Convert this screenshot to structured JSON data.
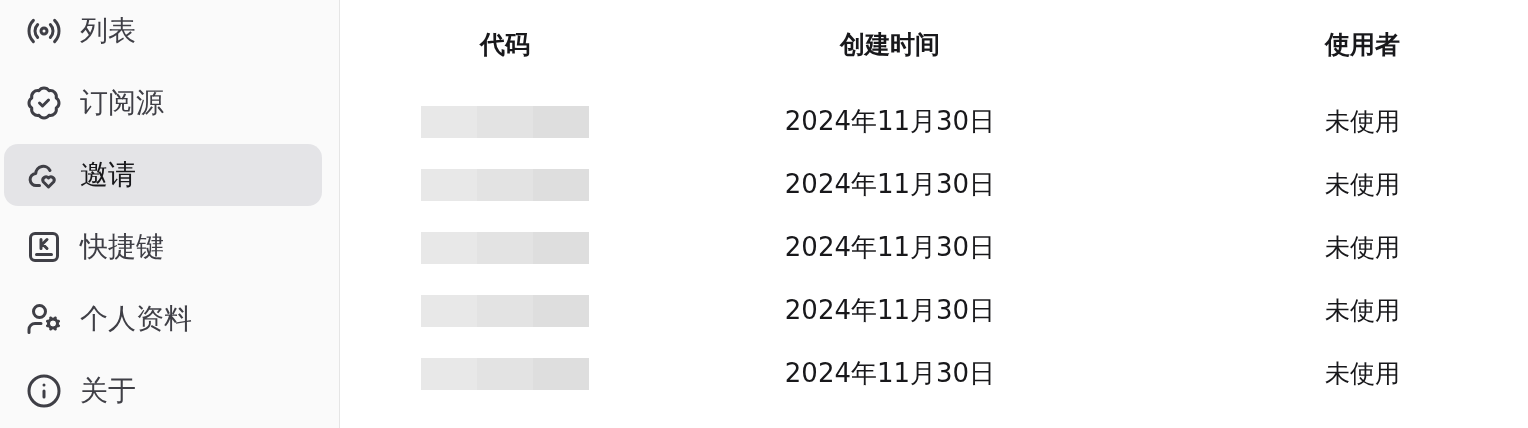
{
  "sidebar": {
    "items": [
      {
        "label": "列表",
        "selected": false
      },
      {
        "label": "订阅源",
        "selected": false
      },
      {
        "label": "邀请",
        "selected": true
      },
      {
        "label": "快捷键",
        "selected": false
      },
      {
        "label": "个人资料",
        "selected": false
      },
      {
        "label": "关于",
        "selected": false
      }
    ]
  },
  "table": {
    "columns": [
      "代码",
      "创建时间",
      "使用者"
    ],
    "rows": [
      {
        "code": {
          "kind": "redacted"
        },
        "created": "2024年11月30日",
        "user": "未使用"
      },
      {
        "code": {
          "kind": "redacted"
        },
        "created": "2024年11月30日",
        "user": "未使用"
      },
      {
        "code": {
          "kind": "redacted"
        },
        "created": "2024年11月30日",
        "user": "未使用"
      },
      {
        "code": {
          "kind": "redacted"
        },
        "created": "2024年11月30日",
        "user": "未使用"
      },
      {
        "code": {
          "kind": "redacted"
        },
        "created": "2024年11月30日",
        "user": "未使用"
      }
    ]
  }
}
